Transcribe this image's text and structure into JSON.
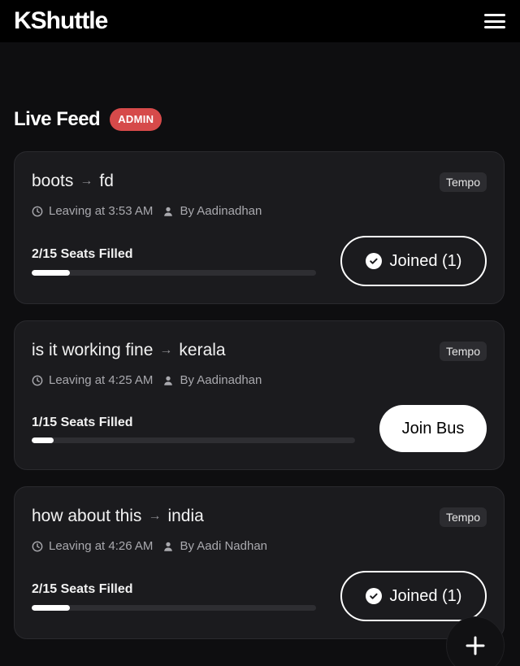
{
  "header": {
    "brand": "KShuttle",
    "menu_icon": "hamburger-menu-icon"
  },
  "feed": {
    "title": "Live Feed",
    "badge": "ADMIN"
  },
  "colors": {
    "background": "#0e0e10",
    "card": "#1b1b1e",
    "badge": "#d64a4a",
    "accent": "#ffffff"
  },
  "rides": [
    {
      "from": "boots",
      "to": "fd",
      "vehicle": "Tempo",
      "leaving": "Leaving at 3:53 AM",
      "by": "By Aadinadhan",
      "seats_label": "2/15 Seats Filled",
      "seats_filled": 2,
      "seats_total": 15,
      "button_label": "Joined (1)",
      "joined": true
    },
    {
      "from": "is it working fine",
      "to": "kerala",
      "vehicle": "Tempo",
      "leaving": "Leaving at 4:25 AM",
      "by": "By Aadinadhan",
      "seats_label": "1/15 Seats Filled",
      "seats_filled": 1,
      "seats_total": 15,
      "button_label": "Join Bus",
      "joined": false
    },
    {
      "from": "how about this",
      "to": "india",
      "vehicle": "Tempo",
      "leaving": "Leaving at 4:26 AM",
      "by": "By Aadi Nadhan",
      "seats_label": "2/15 Seats Filled",
      "seats_filled": 2,
      "seats_total": 15,
      "button_label": "Joined (1)",
      "joined": true
    }
  ],
  "fab": {
    "icon": "plus-icon"
  }
}
